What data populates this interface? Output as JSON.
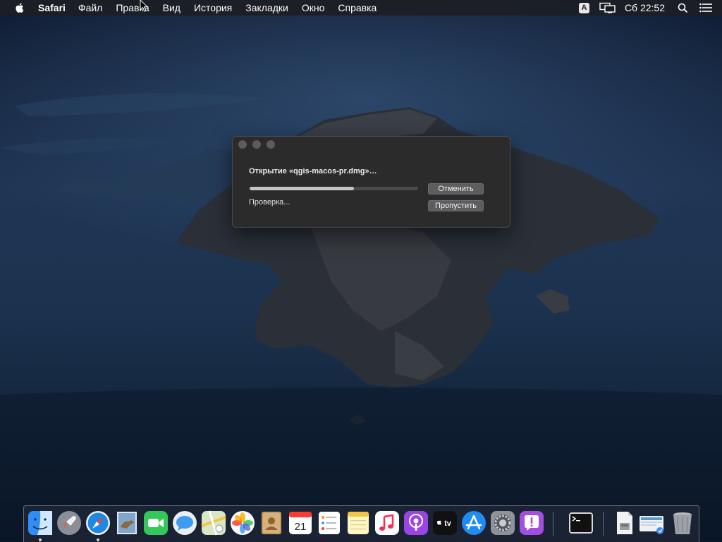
{
  "menubar": {
    "app_name": "Safari",
    "items": [
      "Файл",
      "Правка",
      "Вид",
      "История",
      "Закладки",
      "Окно",
      "Справка"
    ],
    "input_source": "A",
    "clock": "Сб 22:52"
  },
  "dialog": {
    "title": "Открытие «qgis-macos-pr.dmg»…",
    "status": "Проверка...",
    "progress": 0.62,
    "cancel_label": "Отменить",
    "skip_label": "Пропустить"
  },
  "dock": {
    "apps": [
      "finder-icon",
      "launchpad-icon",
      "safari-icon",
      "mail-icon",
      "facetime-icon",
      "messages-icon",
      "maps-icon",
      "photos-icon",
      "contacts-icon",
      "calendar-icon",
      "reminders-icon",
      "notes-icon",
      "music-icon",
      "podcasts-icon",
      "apple-tv-icon",
      "app-store-icon",
      "system-preferences-icon",
      "feedback-assistant-icon",
      "terminal-icon",
      "disk-image-icon",
      "downloads-stack-icon",
      "trash-icon"
    ],
    "calendar_day": "21",
    "tv_label": "tv",
    "running": [
      "finder-icon",
      "safari-icon"
    ]
  }
}
